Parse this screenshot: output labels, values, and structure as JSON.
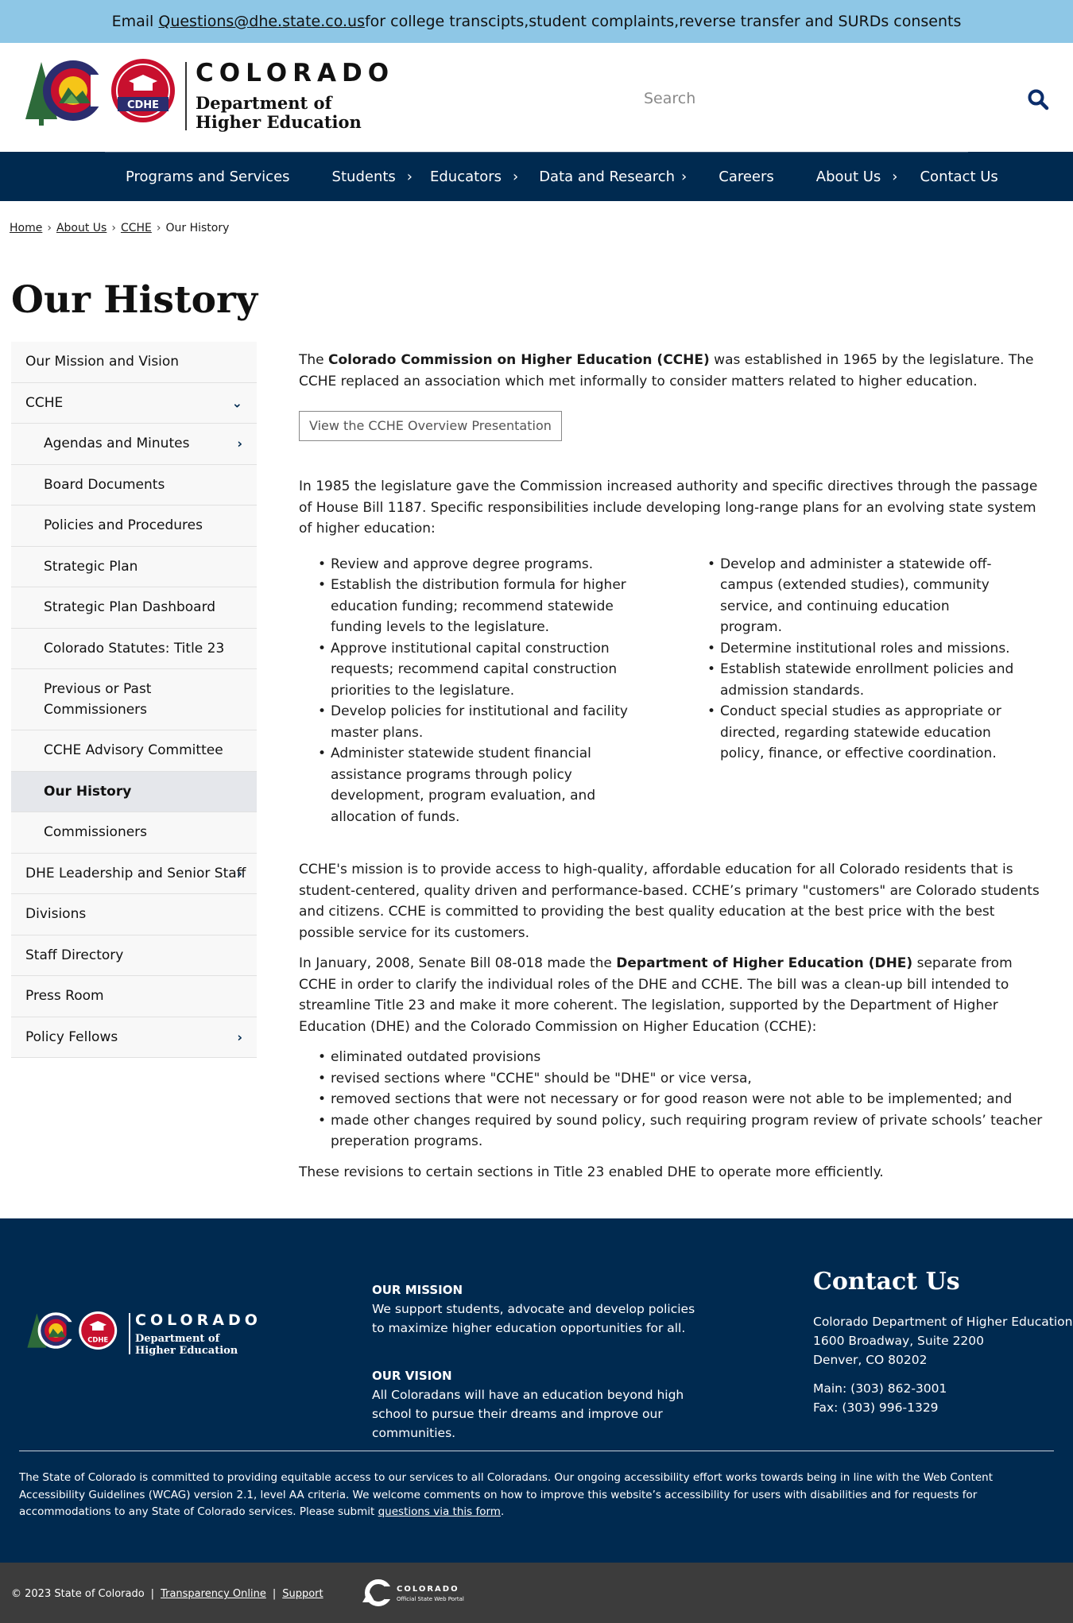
{
  "banner": {
    "prefix": "Email ",
    "email": "Questions@dhe.state.co.us",
    "suffix": " for college transcipts,student complaints,reverse transfer and SURDs consents"
  },
  "header": {
    "logo_word": "COLORADO",
    "logo_line1": "Department of",
    "logo_line2": "Higher Education",
    "seal_text": "CDHE",
    "search_placeholder": "Search"
  },
  "nav": [
    {
      "label": "Programs and Services",
      "has_children": false
    },
    {
      "label": "Students",
      "has_children": true
    },
    {
      "label": "Educators",
      "has_children": true
    },
    {
      "label": "Data and Research",
      "has_children": true
    },
    {
      "label": "Careers",
      "has_children": false
    },
    {
      "label": "About Us",
      "has_children": true
    },
    {
      "label": "Contact Us",
      "has_children": false
    }
  ],
  "breadcrumb": [
    "Home",
    "About Us",
    "CCHE",
    "Our History"
  ],
  "page_title": "Our History",
  "sidebar": {
    "items": [
      {
        "label": "Our Mission and Vision"
      },
      {
        "label": "CCHE"
      },
      {
        "label": "Agendas and Minutes"
      },
      {
        "label": "Board Documents"
      },
      {
        "label": "Policies and Procedures"
      },
      {
        "label": "Strategic Plan"
      },
      {
        "label": "Strategic Plan Dashboard"
      },
      {
        "label": "Colorado Statutes: Title 23"
      },
      {
        "label": "Previous or Past Commissioners"
      },
      {
        "label": "CCHE Advisory Committee"
      },
      {
        "label": "Our History"
      },
      {
        "label": "Commissioners"
      },
      {
        "label": "DHE Leadership and Senior Staff"
      },
      {
        "label": "Divisions"
      },
      {
        "label": "Staff Directory"
      },
      {
        "label": "Press Room"
      },
      {
        "label": "Policy Fellows"
      }
    ]
  },
  "content": {
    "intro_pre": "The ",
    "intro_bold": "Colorado Commission on Higher Education (CCHE)",
    "intro_post": " was established in 1965 by the legislature. The CCHE replaced an association which met informally to consider matters related to higher education.",
    "overview_button": "View the CCHE Overview Presentation",
    "para_1985": "In 1985 the legislature gave the Commission increased authority and specific directives through the passage of House Bill 1187. Specific responsibilities include developing long-range plans for an evolving state system of higher education:",
    "resp_left": [
      "Review and approve degree programs.",
      "Establish the distribution formula for higher education funding; recommend statewide funding levels to the legislature.",
      "Approve institutional capital construction requests; recommend capital construction priorities to the legislature.",
      "Develop policies for institutional and facility master plans.",
      "Administer statewide student financial assistance programs through policy development, program evaluation, and allocation of funds."
    ],
    "resp_right": [
      "Develop and administer a statewide off-campus (extended studies), community service, and continuing education program.",
      "Determine institutional roles and missions.",
      "Establish statewide enrollment policies and admission standards.",
      "Conduct special studies as appropriate or directed, regarding statewide education policy, finance, or effective coordination."
    ],
    "mission_para": "CCHE's mission is to provide access to high-quality, affordable education for all Colorado residents that is student-centered, quality driven and performance-based. CCHE’s primary \"customers\" are Colorado students and citizens. CCHE is committed to providing the best quality education at the best price with the best possible service for its customers.",
    "sb_pre": "In January, 2008, Senate Bill 08-018 made the ",
    "sb_bold": "Department of Higher Education (DHE)",
    "sb_post": " separate from CCHE in order to clarify the individual roles of the DHE and CCHE. The bill was a clean-up bill intended to streamline Title 23 and make it more coherent. The legislation, supported by the Department of Higher Education (DHE) and the Colorado Commission on Higher Education (CCHE):",
    "sb_list": [
      "eliminated outdated provisions",
      "revised sections where \"CCHE\" should be \"DHE\" or vice versa,",
      "removed sections that were not necessary or for good reason were not able to be implemented; and",
      "made other changes required by sound policy, such requiring program review of private schools’ teacher preperation programs."
    ],
    "closing": "These revisions to certain sections in Title 23 enabled DHE to operate more efficiently."
  },
  "footer": {
    "logo_word": "COLORADO",
    "logo_line1": "Department of",
    "logo_line2": "Higher Education",
    "seal_text": "CDHE",
    "mission_head": "OUR MISSION",
    "mission_text": "We support students, advocate and develop policies to maximize higher education opportunities for all.",
    "vision_head": "OUR VISION",
    "vision_text": "All Coloradans will have an education beyond high school to pursue their dreams and improve our communities.",
    "contact_title": "Contact Us",
    "address1": "Colorado Department of Higher Education",
    "address2": "1600 Broadway, Suite 2200",
    "address3": "Denver, CO 80202",
    "main_phone": "Main: (303) 862-3001",
    "fax": "Fax: (303) 996-1329",
    "access_text": "The State of Colorado is committed to providing equitable access to our services to all Coloradans. Our ongoing accessibility effort works towards being in line with the Web Content Accessibility Guidelines (WCAG) version 2.1, level AA criteria. We welcome comments on how to improve this website’s accessibility for users with disabilities and for requests for accommodations to any State of Colorado services. Please submit ",
    "access_link": "questions via this form",
    "access_end": "."
  },
  "bottom": {
    "copyright": "© 2023 State of Colorado",
    "sep": "|",
    "link1": "Transparency Online",
    "link2": "Support",
    "portal_word": "COLORADO",
    "portal_sub": "Official State Web Portal"
  },
  "colors": {
    "banner": "#8ec7e6",
    "navy": "#002a50",
    "bottom_bar": "#3c3c3c",
    "active_side": "#e5e7eb"
  }
}
